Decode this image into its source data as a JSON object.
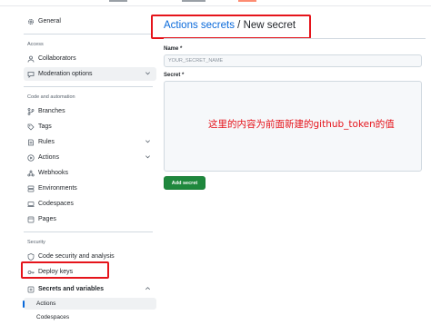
{
  "sidebar": {
    "general_label": "General",
    "access_section": "Access",
    "collaborators_label": "Collaborators",
    "moderation_label": "Moderation options",
    "code_section": "Code and automation",
    "branches_label": "Branches",
    "tags_label": "Tags",
    "rules_label": "Rules",
    "actions_label": "Actions",
    "webhooks_label": "Webhooks",
    "environments_label": "Environments",
    "codespaces_label": "Codespaces",
    "pages_label": "Pages",
    "security_section": "Security",
    "code_security_label": "Code security and analysis",
    "deploy_keys_label": "Deploy keys",
    "secrets_label": "Secrets and variables",
    "sub_actions_label": "Actions",
    "sub_codespaces_label": "Codespaces"
  },
  "main": {
    "breadcrumb_link": "Actions secrets",
    "breadcrumb_rest": " / New secret",
    "name_label": "Name *",
    "name_placeholder": "YOUR_SECRET_NAME",
    "secret_label": "Secret *",
    "secret_annotation": "这里的内容为前面新建的github_token的值",
    "add_button": "Add secret"
  },
  "colors": {
    "annotation_red": "#e5141b",
    "link_blue": "#0969da",
    "button_green": "#1f883d"
  },
  "icons": [
    "gear-icon",
    "person-icon",
    "comment-icon",
    "branch-icon",
    "tag-icon",
    "rules-icon",
    "play-icon",
    "webhook-icon",
    "server-icon",
    "codespaces-icon",
    "browser-icon",
    "shield-icon",
    "key-icon",
    "plus-square-icon",
    "chevron-down-icon",
    "chevron-up-icon"
  ]
}
